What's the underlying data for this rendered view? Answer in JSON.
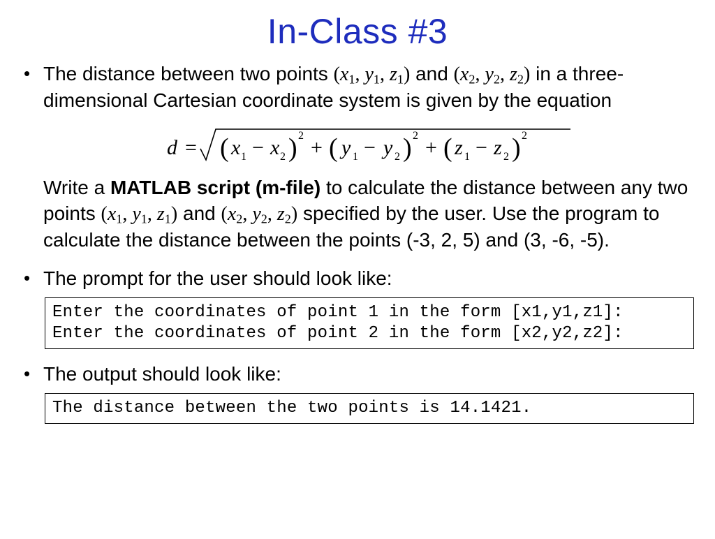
{
  "title": "In-Class #3",
  "bullets": {
    "b1": {
      "s1": "The distance between two points ",
      "p1o": "(",
      "x1": "x",
      "c": ", ",
      "y1": "y",
      "z1": "z",
      "p1c": ")",
      "sub1": "1",
      "sub2": "2",
      "s2": " and ",
      "x2": "x",
      "y2": "y",
      "z2": "z",
      "s3": " in a three-dimensional Cartesian coordinate system is given by the equation",
      "s4": "Write a ",
      "bold": "MATLAB script (m-file)",
      "s5": " to calculate the distance between any two points ",
      "s6": " specified by the user. Use the program to calculate the distance between the points (-3, 2, 5) and (3, -6, -5)."
    },
    "b2": "The prompt for the user should look like:",
    "b3": "The output should look like:"
  },
  "eqn": {
    "d": "d",
    "eq": "=",
    "lp1": "x",
    "lp1s": "1",
    "minus": "−",
    "lp2": "x",
    "lp2s": "2",
    "sq": "2",
    "plus": "+",
    "my1": "y",
    "my2": "y",
    "mz1": "z",
    "mz2": "z"
  },
  "code1": "Enter the coordinates of point 1 in the form [x1,y1,z1]:\nEnter the coordinates of point 2 in the form [x2,y2,z2]:",
  "code2": "The distance between the two points is 14.1421."
}
